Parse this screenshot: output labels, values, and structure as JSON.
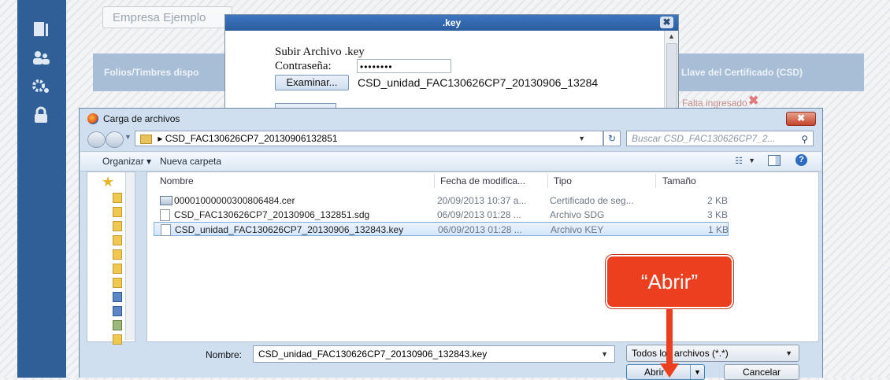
{
  "background_app": {
    "company_select": "Empresa Ejemplo",
    "panel_left_header": "Folios/Timbres dispo",
    "panel_right_header": "Llave del Certificado (CSD)",
    "missing_status": "Falta ingresado",
    "sidebar_icons": [
      "document-icon",
      "users-icon",
      "gears-icon",
      "lock-icon"
    ]
  },
  "key_modal": {
    "title": ".key",
    "heading": "Subir Archivo .key",
    "password_label": "Contraseña:",
    "password_value": "••••••••",
    "browse_label": "Examinar...",
    "selected_file": "CSD_unidad_FAC130626CP7_20130906_13284"
  },
  "file_dialog": {
    "title": "Carga de archivos",
    "address_path": "CSD_FAC130626CP7_20130906132851",
    "search_placeholder": "Buscar CSD_FAC130626CP7_2...",
    "toolbar": {
      "organize": "Organizar ▾",
      "new_folder": "Nueva carpeta"
    },
    "columns": [
      "Nombre",
      "Fecha de modifica...",
      "Tipo",
      "Tamaño"
    ],
    "files": [
      {
        "name": "00001000000300806484.cer",
        "date": "20/09/2013 10:37 a...",
        "type": "Certificado de seg...",
        "size": "2 KB",
        "selected": false
      },
      {
        "name": "CSD_FAC130626CP7_20130906_132851.sdg",
        "date": "06/09/2013 01:28 ...",
        "type": "Archivo SDG",
        "size": "3 KB",
        "selected": false
      },
      {
        "name": "CSD_unidad_FAC130626CP7_20130906_132843.key",
        "date": "06/09/2013 01:28 ...",
        "type": "Archivo KEY",
        "size": "1 KB",
        "selected": true
      }
    ],
    "name_label": "Nombre:",
    "name_value": "CSD_unidad_FAC130626CP7_20130906_132843.key",
    "filter_value": "Todos los archivos (*.*)",
    "open_button": "Abrir",
    "cancel_button": "Cancelar"
  },
  "annotation": {
    "callout_text": "“Abrir”",
    "color": "#ec3f1f"
  }
}
